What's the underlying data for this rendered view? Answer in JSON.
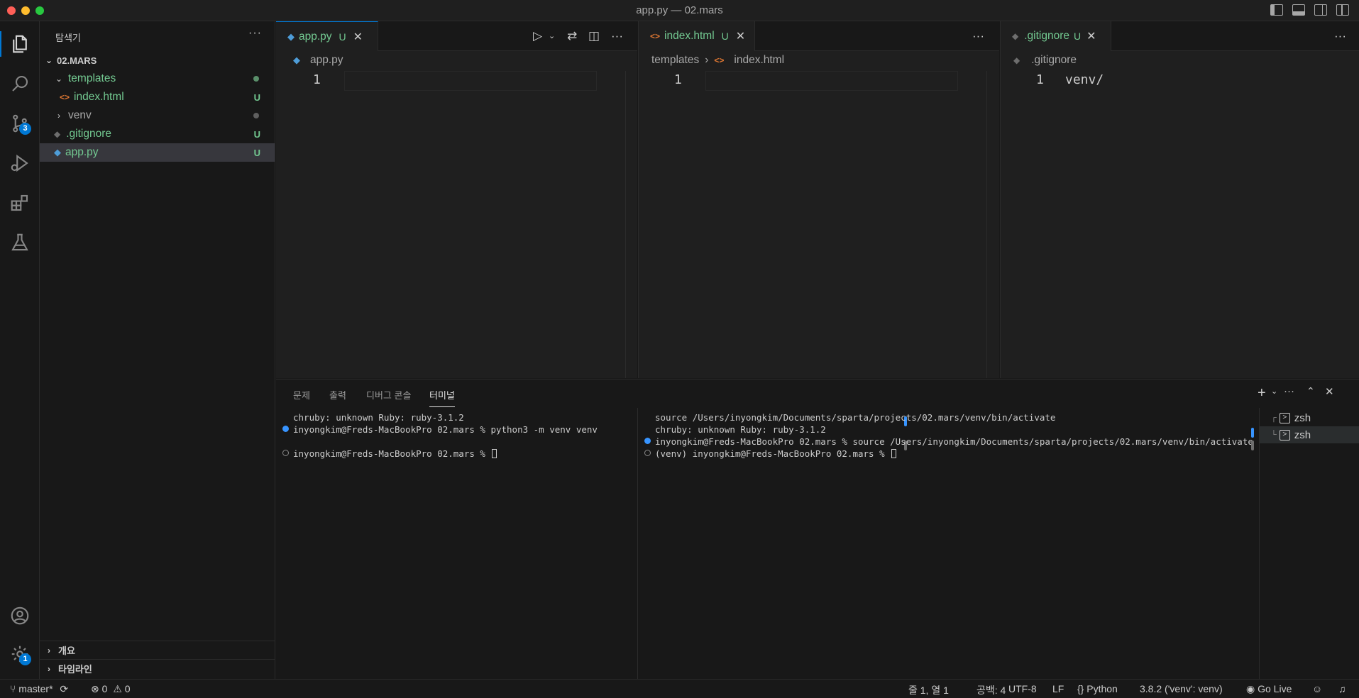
{
  "window": {
    "title": "app.py — 02.mars"
  },
  "activity_bar": {
    "scm_badge": "3",
    "settings_badge": "1"
  },
  "sidebar": {
    "title": "탐색기",
    "root": "02.MARS",
    "items": [
      {
        "label": "templates",
        "status": ""
      },
      {
        "label": "index.html",
        "status": "U"
      },
      {
        "label": "venv",
        "status": ""
      },
      {
        "label": ".gitignore",
        "status": "U"
      },
      {
        "label": "app.py",
        "status": "U"
      }
    ],
    "outline": "개요",
    "timeline": "타임라인"
  },
  "editors": [
    {
      "tab": "app.py",
      "status": "U",
      "breadcrumb": [
        "app.py"
      ],
      "line": "1",
      "content": ""
    },
    {
      "tab": "index.html",
      "status": "U",
      "breadcrumb": [
        "templates",
        "index.html"
      ],
      "line": "1",
      "content": ""
    },
    {
      "tab": ".gitignore",
      "status": "U",
      "breadcrumb": [
        ".gitignore"
      ],
      "line": "1",
      "content": "venv/"
    }
  ],
  "panel": {
    "tabs": [
      "문제",
      "출력",
      "디버그 콘솔",
      "터미널"
    ],
    "active_tab": "터미널",
    "terminal_left": [
      "chruby: unknown Ruby: ruby-3.1.2",
      "inyongkim@Freds-MacBookPro 02.mars % python3 -m venv venv",
      "inyongkim@Freds-MacBookPro 02.mars % "
    ],
    "terminal_right": [
      "source /Users/inyongkim/Documents/sparta/projects/02.mars/venv/bin/activate",
      "chruby: unknown Ruby: ruby-3.1.2",
      "inyongkim@Freds-MacBookPro 02.mars % source /Users/inyongkim/Documents/sparta/projects/02.mars/venv/bin/activate",
      "(venv) inyongkim@Freds-MacBookPro 02.mars % "
    ],
    "terminals": [
      "zsh",
      "zsh"
    ]
  },
  "status_bar": {
    "branch": "master*",
    "errors": "0",
    "warnings": "0",
    "position": "줄 1, 열 1",
    "spaces": "공백: 4",
    "encoding": "UTF-8",
    "eol": "LF",
    "language": "Python",
    "interpreter": "3.8.2 ('venv': venv)",
    "go_live": "Go Live"
  }
}
